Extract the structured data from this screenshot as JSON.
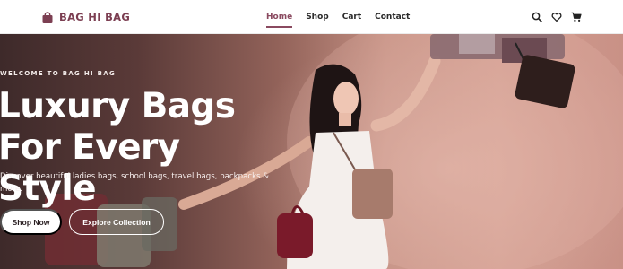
{
  "brand": {
    "name": "BAG HI BAG",
    "color": "#7c3f52"
  },
  "nav": {
    "links": [
      {
        "label": "Home",
        "active": true
      },
      {
        "label": "Shop",
        "active": false
      },
      {
        "label": "Cart",
        "active": false
      },
      {
        "label": "Contact",
        "active": false
      }
    ],
    "icons": [
      "search-icon",
      "heart-icon",
      "cart-icon"
    ]
  },
  "hero": {
    "eyebrow": "WELCOME TO BAG HI BAG",
    "headline_line1": "Luxury Bags",
    "headline_line2": "For Every Style",
    "subtext": "Discover beautiful ladies bags, school bags, travel bags, backpacks & more.",
    "primary_button": "Shop Now",
    "secondary_button": "Explore Collection"
  },
  "colors": {
    "accent": "#8a4a60",
    "hero_dark": "#3e2a2a",
    "hero_light": "#d19d90"
  }
}
